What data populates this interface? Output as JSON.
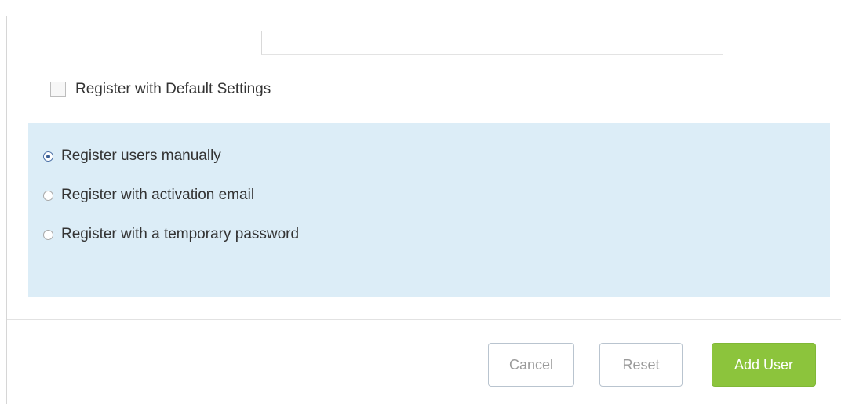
{
  "form": {
    "default_settings_label": "Register with Default Settings",
    "default_settings_checked": false
  },
  "registration": {
    "options": [
      {
        "label": "Register users manually",
        "selected": true
      },
      {
        "label": "Register with activation email",
        "selected": false
      },
      {
        "label": "Register with a temporary password",
        "selected": false
      }
    ]
  },
  "footer": {
    "cancel_label": "Cancel",
    "reset_label": "Reset",
    "add_user_label": "Add User"
  },
  "colors": {
    "panel_background": "#dcedf7",
    "primary_button": "#8cc43c"
  }
}
